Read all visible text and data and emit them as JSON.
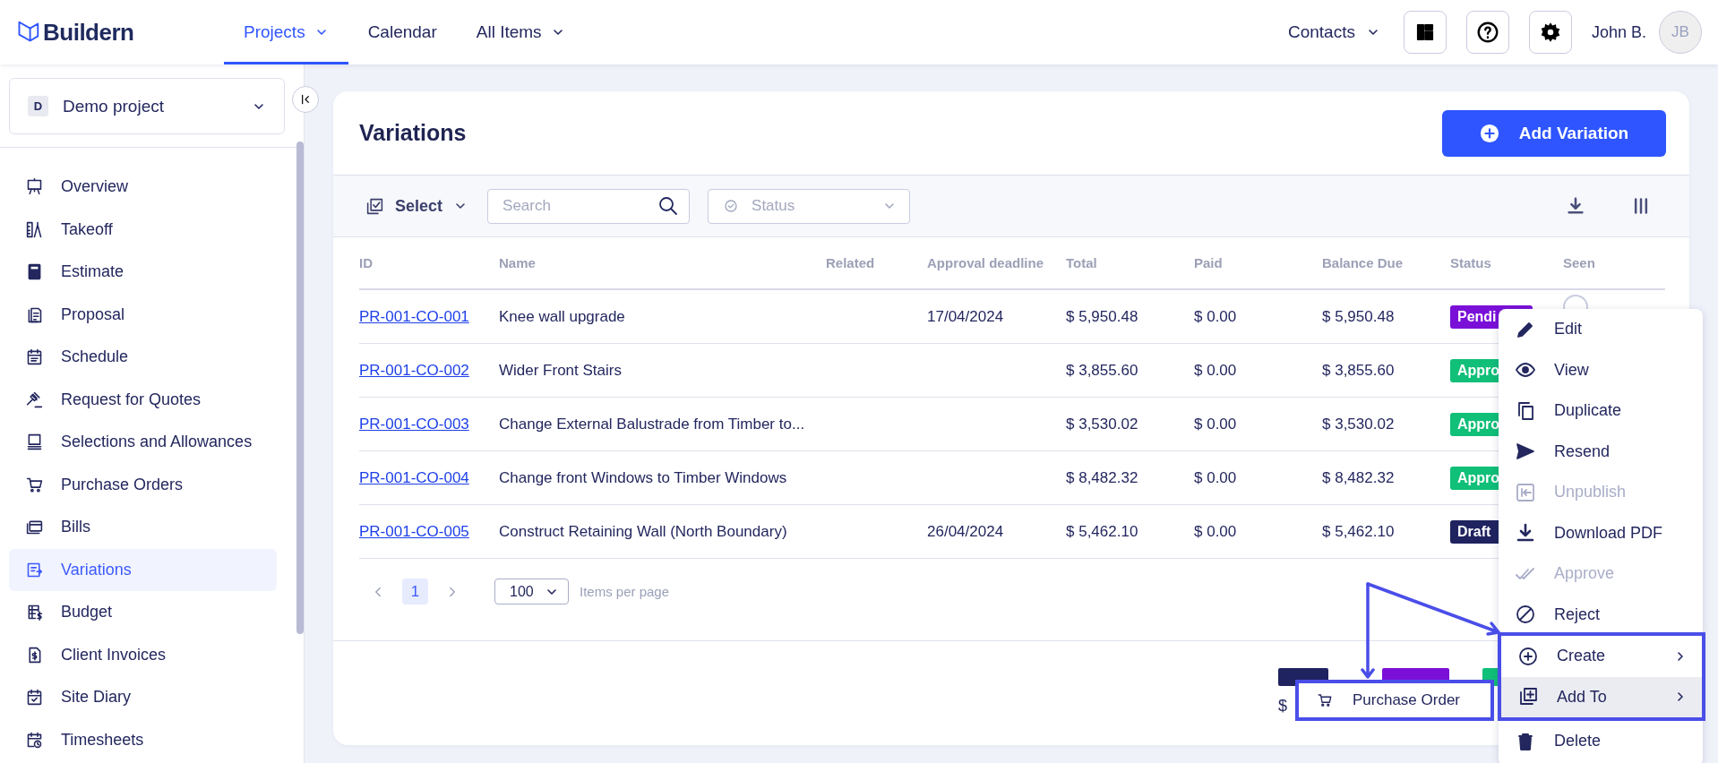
{
  "app": {
    "logo": "Buildern"
  },
  "nav": [
    {
      "label": "Projects",
      "selected": true,
      "dropdown": true
    },
    {
      "label": "Calendar",
      "selected": false,
      "dropdown": false
    },
    {
      "label": "All Items",
      "selected": false,
      "dropdown": true
    }
  ],
  "header_right": {
    "contacts": "Contacts",
    "user_name": "John B.",
    "avatar_initials": "JB"
  },
  "project_selector": {
    "badge": "D",
    "name": "Demo project"
  },
  "sidebar": {
    "items": [
      {
        "label": "Overview",
        "selected": false
      },
      {
        "label": "Takeoff",
        "selected": false
      },
      {
        "label": "Estimate",
        "selected": false
      },
      {
        "label": "Proposal",
        "selected": false
      },
      {
        "label": "Schedule",
        "selected": false
      },
      {
        "label": "Request for Quotes",
        "selected": false
      },
      {
        "label": "Selections and Allowances",
        "selected": false
      },
      {
        "label": "Purchase Orders",
        "selected": false
      },
      {
        "label": "Bills",
        "selected": false
      },
      {
        "label": "Variations",
        "selected": true
      },
      {
        "label": "Budget",
        "selected": false
      },
      {
        "label": "Client Invoices",
        "selected": false
      },
      {
        "label": "Site Diary",
        "selected": false
      },
      {
        "label": "Timesheets",
        "selected": false
      }
    ]
  },
  "page": {
    "title": "Variations",
    "add_button": "Add Variation"
  },
  "toolbar": {
    "select": "Select",
    "search_placeholder": "Search",
    "status_placeholder": "Status"
  },
  "table": {
    "columns": [
      "ID",
      "Name",
      "Related",
      "Approval deadline",
      "Total",
      "Paid",
      "Balance Due",
      "Status",
      "Seen"
    ],
    "rows": [
      {
        "id": "PR-001-CO-001",
        "name": "Knee wall upgrade",
        "approval_deadline": "17/04/2024",
        "total": "$ 5,950.48",
        "paid": "$ 0.00",
        "balance_due": "$ 5,950.48",
        "status": {
          "label": "Pendi",
          "color": "#7a10d8"
        }
      },
      {
        "id": "PR-001-CO-002",
        "name": "Wider Front Stairs",
        "total": "$ 3,855.60",
        "paid": "$ 0.00",
        "balance_due": "$ 3,855.60",
        "status": {
          "label": "Appro",
          "color": "#10bf78"
        }
      },
      {
        "id": "PR-001-CO-003",
        "name": "Change External Balustrade from Timber to...",
        "total": "$ 3,530.02",
        "paid": "$ 0.00",
        "balance_due": "$ 3,530.02",
        "status": {
          "label": "Appro",
          "color": "#10bf78"
        }
      },
      {
        "id": "PR-001-CO-004",
        "name": "Change front Windows to Timber Windows",
        "total": "$ 8,482.32",
        "paid": "$ 0.00",
        "balance_due": "$ 8,482.32",
        "status": {
          "label": "Appro",
          "color": "#10bf78"
        }
      },
      {
        "id": "PR-001-CO-005",
        "name": "Construct Retaining Wall (North Boundary)",
        "approval_deadline": "26/04/2024",
        "total": "$ 5,462.10",
        "paid": "$ 0.00",
        "balance_due": "$ 5,462.10",
        "status": {
          "label": "Draft",
          "color": "#1f235f"
        }
      }
    ]
  },
  "pagination": {
    "pages": [
      {
        "label": "1",
        "selected": true
      }
    ],
    "per_page": "100",
    "per_page_label": "Items per page"
  },
  "summary": {
    "tags": [
      {
        "color": "#1f235f"
      },
      {
        "color": "#7a10d8"
      },
      {
        "color": "#10bf78"
      }
    ],
    "amount": "$"
  },
  "context_menu": {
    "items": [
      {
        "label": "Edit",
        "disabled": false,
        "submenu": false,
        "selected": false
      },
      {
        "label": "View",
        "disabled": false,
        "submenu": false,
        "selected": false
      },
      {
        "label": "Duplicate",
        "disabled": false,
        "submenu": false,
        "selected": false
      },
      {
        "label": "Resend",
        "disabled": false,
        "submenu": false,
        "selected": false
      },
      {
        "label": "Unpublish",
        "disabled": true,
        "submenu": false,
        "selected": false
      },
      {
        "label": "Download PDF",
        "disabled": false,
        "submenu": false,
        "selected": false
      },
      {
        "label": "Approve",
        "disabled": true,
        "submenu": false,
        "selected": false
      },
      {
        "label": "Reject",
        "disabled": false,
        "submenu": false,
        "selected": false
      },
      {
        "label": "Create",
        "disabled": false,
        "submenu": true,
        "selected": false
      },
      {
        "label": "Add To",
        "disabled": false,
        "submenu": true,
        "selected": true
      },
      {
        "label": "Delete",
        "disabled": false,
        "submenu": false,
        "selected": false
      }
    ]
  },
  "submenu": {
    "items": [
      {
        "label": "Purchase Order"
      }
    ]
  }
}
